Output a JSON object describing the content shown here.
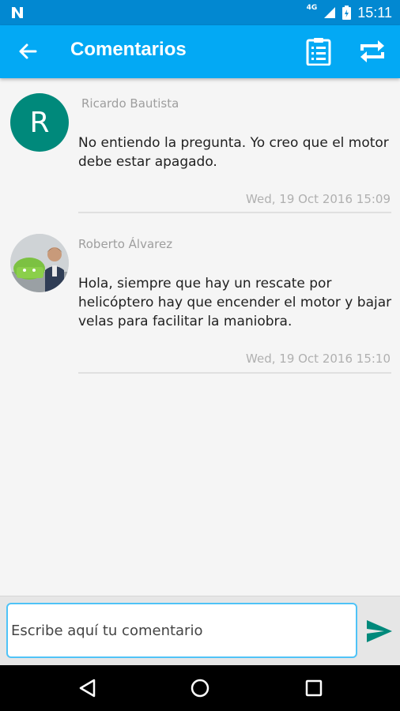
{
  "status_bar": {
    "network": "4G",
    "time": "15:11"
  },
  "app_bar": {
    "title": "Comentarios",
    "icons": [
      "back-arrow-icon",
      "clipboard-icon",
      "repeat-icon"
    ]
  },
  "comments": [
    {
      "avatar_letter": "R",
      "avatar_color": "#00897b",
      "author": "Ricardo Bautista",
      "text": "No entiendo la pregunta. Yo creo que el motor debe estar apagado.",
      "date": "Wed, 19 Oct 2016 15:09"
    },
    {
      "avatar_type": "photo",
      "author": "Roberto Álvarez",
      "text": "Hola, siempre que hay un rescate por helicóptero hay que encender el motor y bajar velas para facilitar la maniobra.",
      "date": "Wed, 19 Oct 2016 15:10"
    }
  ],
  "comment_input": {
    "placeholder": "Escribe aquí tu comentario",
    "value": ""
  },
  "colors": {
    "status_bar": "#0288d1",
    "app_bar": "#03a9f4",
    "send_icon": "#00897b"
  }
}
